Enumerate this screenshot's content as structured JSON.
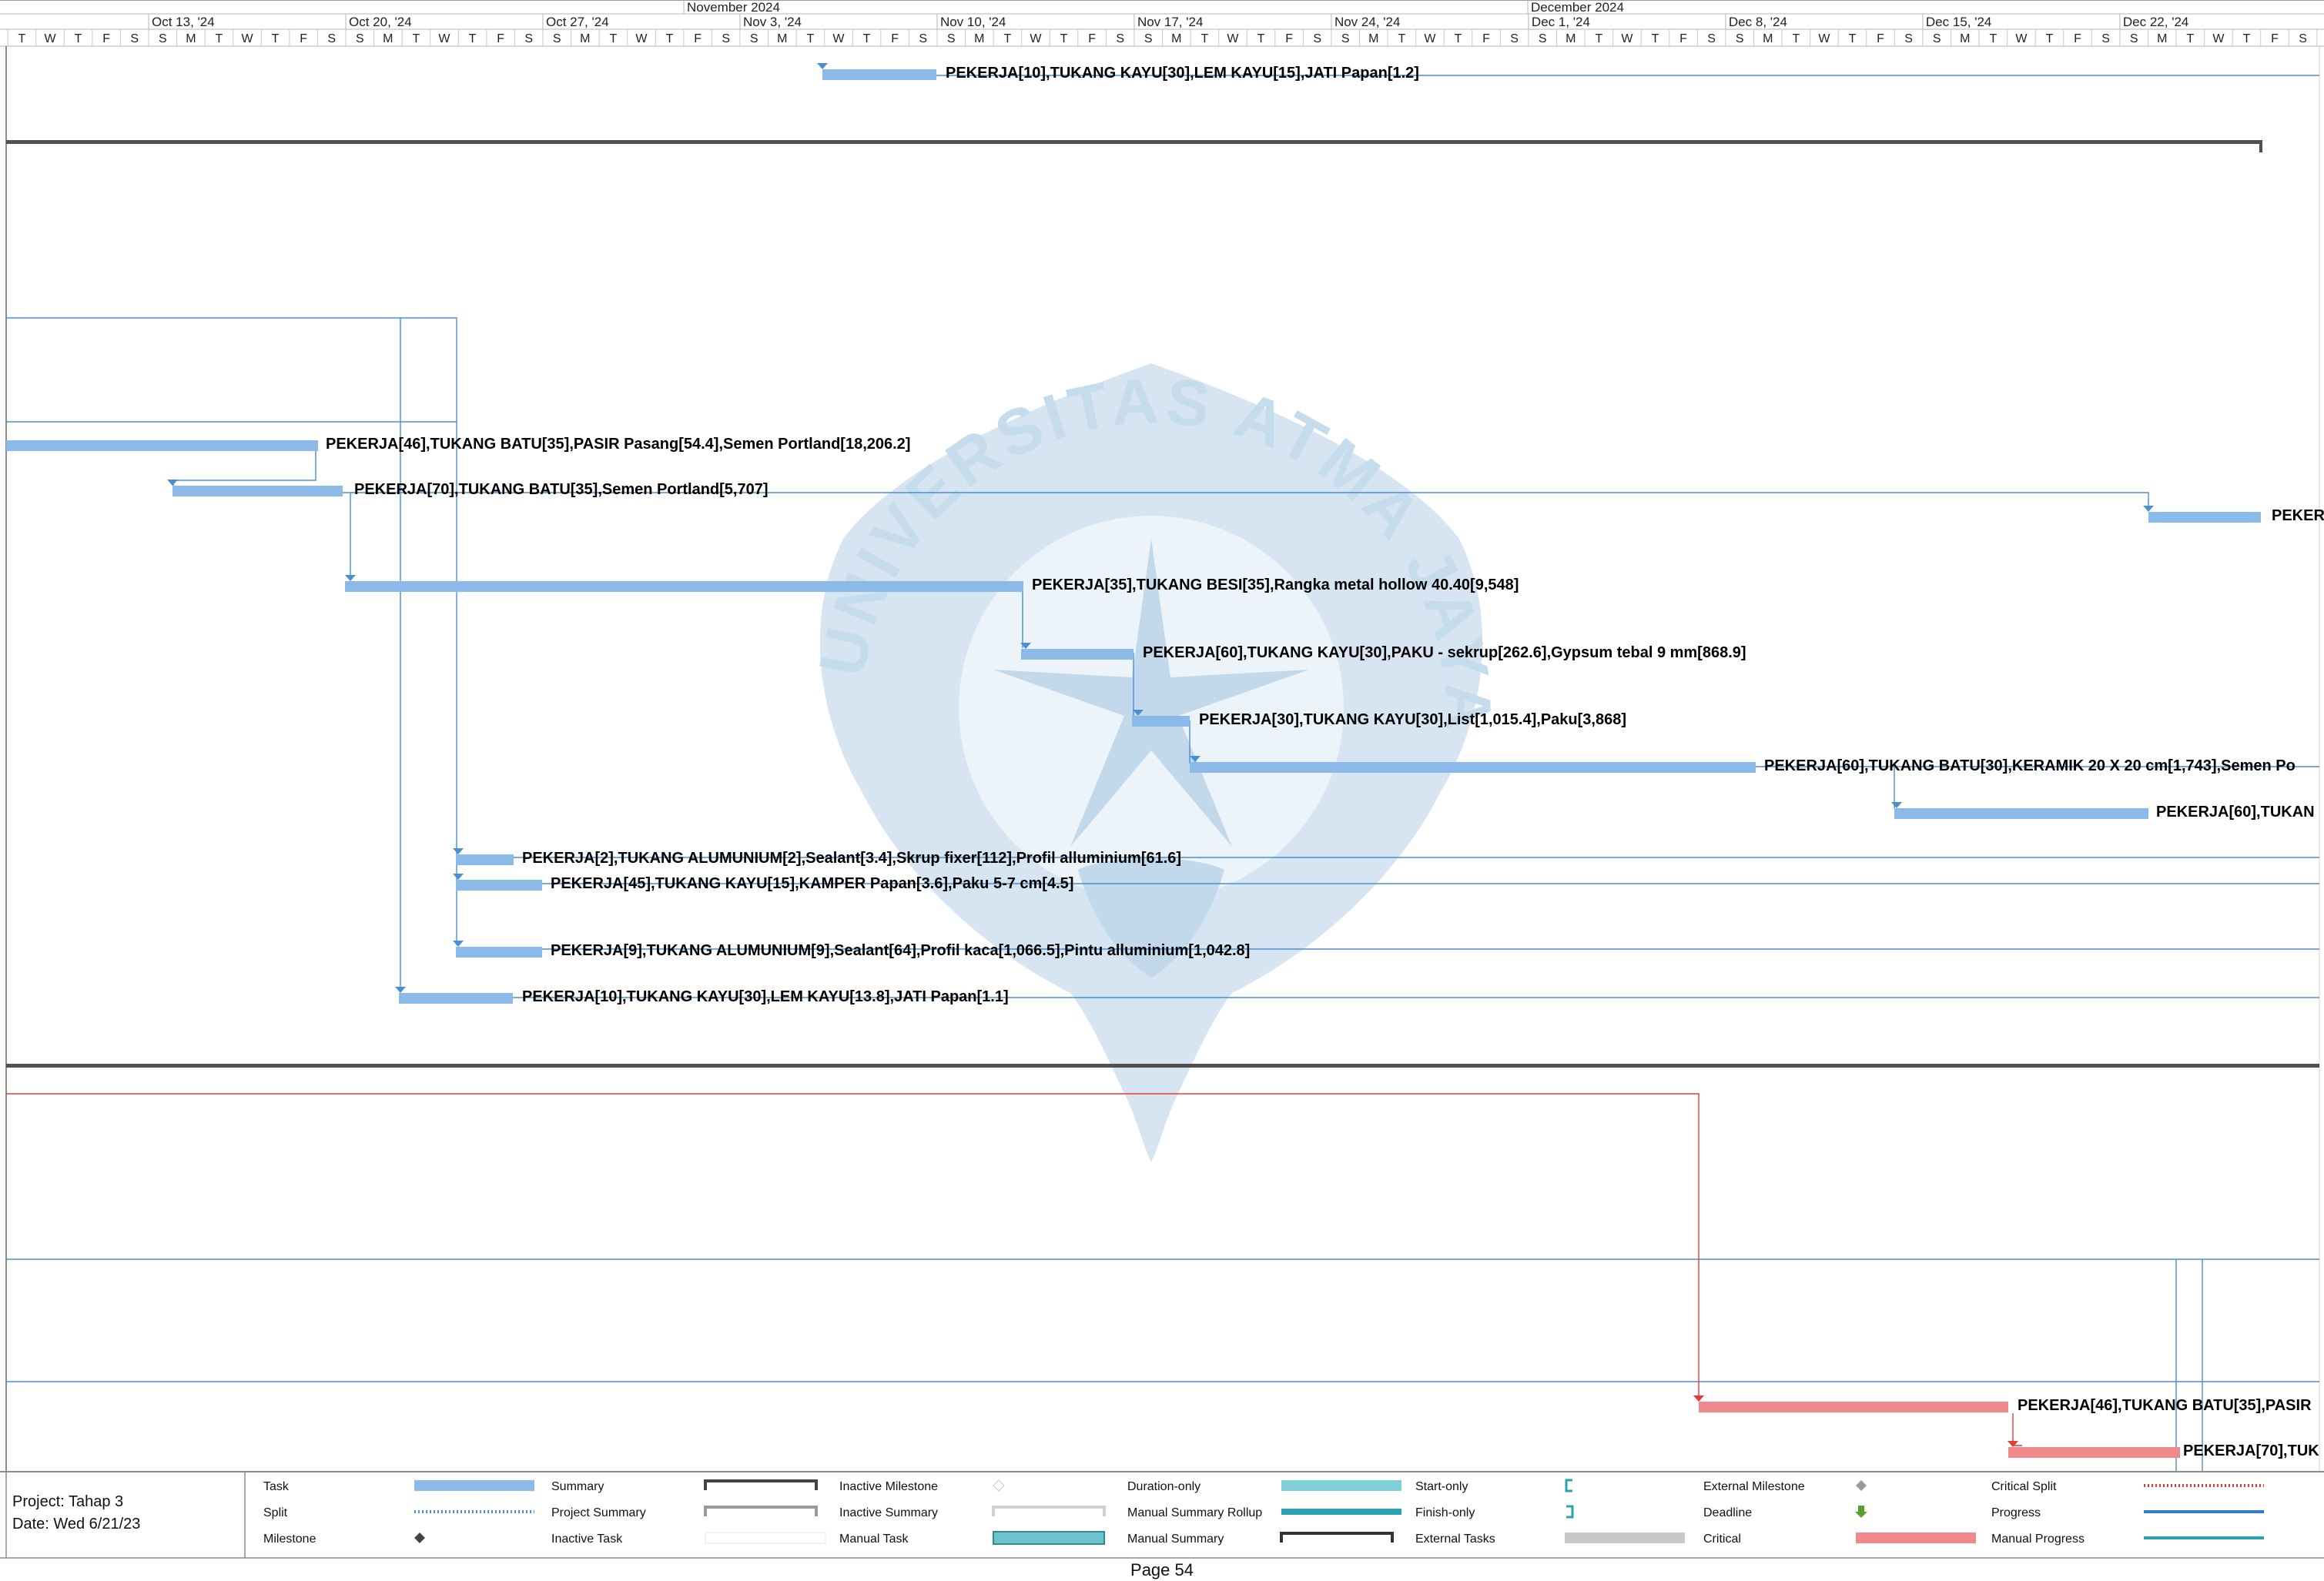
{
  "timescale": {
    "months": [
      "November 2024",
      "December 2024"
    ],
    "weeks": [
      "Oct 13, '24",
      "Oct 20, '24",
      "Oct 27, '24",
      "Nov 3, '24",
      "Nov 10, '24",
      "Nov 17, '24",
      "Nov 24, '24",
      "Dec 1, '24",
      "Dec 8, '24",
      "Dec 15, '24",
      "Dec 22, '24"
    ],
    "day_letters": [
      "S",
      "M",
      "T",
      "W",
      "T",
      "F",
      "S"
    ]
  },
  "tasks": [
    {
      "label": "PEKERJA[10],TUKANG KAYU[30],LEM KAYU[15],JATI Papan[1.2]",
      "color": "#8bb9e8"
    },
    {
      "label": "PEKERJA[46],TUKANG BATU[35],PASIR Pasang[54.4],Semen Portland[18,206.2]",
      "color": "#8bb9e8"
    },
    {
      "label": "PEKERJA[70],TUKANG BATU[35],Semen Portland[5,707]",
      "color": "#8bb9e8"
    },
    {
      "label": "PEKER",
      "color": "#8bb9e8"
    },
    {
      "label": "PEKERJA[35],TUKANG BESI[35],Rangka metal hollow 40.40[9,548]",
      "color": "#8bb9e8"
    },
    {
      "label": "PEKERJA[60],TUKANG KAYU[30],PAKU - sekrup[262.6],Gypsum tebal 9 mm[868.9]",
      "color": "#8bb9e8"
    },
    {
      "label": "PEKERJA[30],TUKANG KAYU[30],List[1,015.4],Paku[3,868]",
      "color": "#8bb9e8"
    },
    {
      "label": "PEKERJA[60],TUKANG BATU[30],KERAMIK 20 X 20 cm[1,743],Semen Po",
      "color": "#8bb9e8"
    },
    {
      "label": "PEKERJA[60],TUKAN",
      "color": "#8bb9e8"
    },
    {
      "label": "PEKERJA[2],TUKANG ALUMUNIUM[2],Sealant[3.4],Skrup fixer[112],Profil alluminium[61.6]",
      "color": "#8bb9e8"
    },
    {
      "label": "PEKERJA[45],TUKANG KAYU[15],KAMPER Papan[3.6],Paku 5-7 cm[4.5]",
      "color": "#8bb9e8"
    },
    {
      "label": "PEKERJA[9],TUKANG ALUMUNIUM[9],Sealant[64],Profil kaca[1,066.5],Pintu alluminium[1,042.8]",
      "color": "#8bb9e8"
    },
    {
      "label": "PEKERJA[10],TUKANG KAYU[30],LEM KAYU[13.8],JATI Papan[1.1]",
      "color": "#8bb9e8"
    },
    {
      "label": "PEKERJA[46],TUKANG BATU[35],PASIR",
      "color": "#f08a8a"
    },
    {
      "label": "PEKERJA[70],TUK",
      "color": "#f08a8a"
    }
  ],
  "watermark": {
    "text": "UNIVERSITAS ATMA JAYA YOGYAKARTA",
    "color": "#bcd6ea"
  },
  "legend": {
    "project_label": "Project: Tahap 3",
    "date_label": "Date: Wed 6/21/23",
    "items": [
      {
        "label": "Task",
        "icon": "task-bar"
      },
      {
        "label": "Split",
        "icon": "split-dots"
      },
      {
        "label": "Milestone",
        "icon": "milestone-diamond"
      },
      {
        "label": "Summary",
        "icon": "summary-bracket"
      },
      {
        "label": "Project Summary",
        "icon": "project-summary-bracket"
      },
      {
        "label": "Inactive Task",
        "icon": "inactive-task-bar"
      },
      {
        "label": "Inactive Milestone",
        "icon": "inactive-milestone-diamond"
      },
      {
        "label": "Inactive Summary",
        "icon": "inactive-summary-bracket"
      },
      {
        "label": "Manual Task",
        "icon": "manual-task-bar"
      },
      {
        "label": "Duration-only",
        "icon": "duration-only-bar"
      },
      {
        "label": "Manual Summary Rollup",
        "icon": "manual-summary-rollup-line"
      },
      {
        "label": "Manual Summary",
        "icon": "manual-summary-bracket"
      },
      {
        "label": "Start-only",
        "icon": "start-only-bracket"
      },
      {
        "label": "Finish-only",
        "icon": "finish-only-bracket"
      },
      {
        "label": "External Tasks",
        "icon": "external-tasks-bar"
      },
      {
        "label": "External Milestone",
        "icon": "external-milestone-diamond"
      },
      {
        "label": "Deadline",
        "icon": "deadline-arrow"
      },
      {
        "label": "Critical",
        "icon": "critical-bar"
      },
      {
        "label": "Critical Split",
        "icon": "critical-split-dots"
      },
      {
        "label": "Progress",
        "icon": "progress-line"
      },
      {
        "label": "Manual Progress",
        "icon": "manual-progress-line"
      }
    ]
  },
  "page": {
    "label": "Page 54"
  },
  "colors": {
    "task": "#8bb9e8",
    "link": "#4a8fd1",
    "critical": "#f08a8a",
    "critical_link": "#e03c3c",
    "summary": "#444444",
    "grid": "#c8c8c8"
  }
}
